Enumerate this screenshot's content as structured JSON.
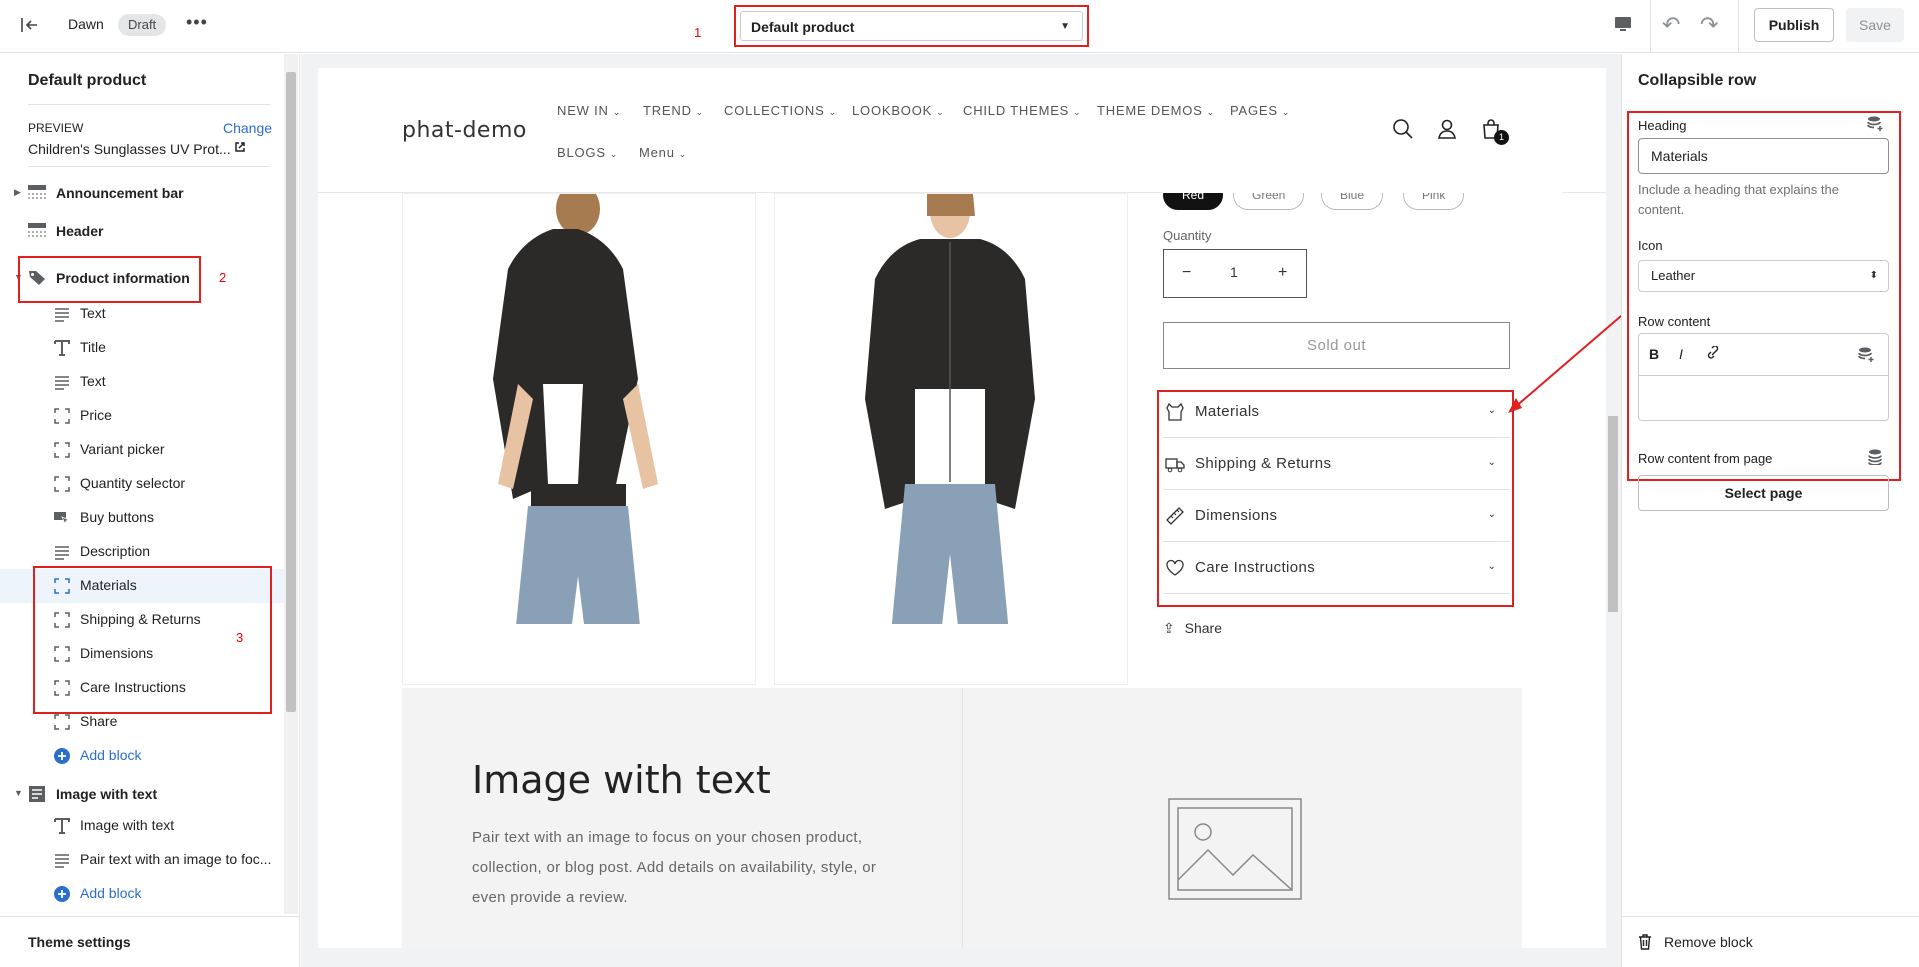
{
  "topbar": {
    "theme_name": "Dawn",
    "badge": "Draft",
    "more": "•••",
    "annotation": "1",
    "template_select": "Default product",
    "publish_label": "Publish",
    "save_label": "Save"
  },
  "left_panel": {
    "title": "Default product",
    "preview_label": "PREVIEW",
    "change_label": "Change",
    "preview_product": "Children's Sunglasses UV Prot...",
    "sections": [
      {
        "label": "Announcement bar",
        "icon": "section-icon"
      },
      {
        "label": "Header",
        "icon": "section-icon"
      },
      {
        "label": "Product information",
        "icon": "tag-icon"
      }
    ],
    "product_blocks": [
      {
        "label": "Text",
        "icon": "text-lines-icon"
      },
      {
        "label": "Title",
        "icon": "title-t-icon"
      },
      {
        "label": "Text",
        "icon": "text-lines-icon"
      },
      {
        "label": "Price",
        "icon": "dashed-square-icon"
      },
      {
        "label": "Variant picker",
        "icon": "dashed-square-icon"
      },
      {
        "label": "Quantity selector",
        "icon": "dashed-square-icon"
      },
      {
        "label": "Buy buttons",
        "icon": "cursor-button-icon"
      },
      {
        "label": "Description",
        "icon": "text-lines-icon"
      },
      {
        "label": "Materials",
        "icon": "dashed-square-icon"
      },
      {
        "label": "Shipping & Returns",
        "icon": "dashed-square-icon"
      },
      {
        "label": "Dimensions",
        "icon": "dashed-square-icon"
      },
      {
        "label": "Care Instructions",
        "icon": "dashed-square-icon"
      },
      {
        "label": "Share",
        "icon": "dashed-square-icon"
      }
    ],
    "add_block": "Add block",
    "image_with_text_section": "Image with text",
    "iwt_blocks": [
      {
        "label": "Image with text",
        "icon": "title-t-icon"
      },
      {
        "label": "Pair text with an image to foc...",
        "icon": "text-lines-icon"
      }
    ],
    "add_block_2": "Add block",
    "theme_settings": "Theme settings",
    "annotation_2": "2",
    "annotation_3": "3"
  },
  "preview": {
    "store_name": "phat-demo",
    "nav_row1": [
      "NEW IN",
      "TREND",
      "COLLECTIONS",
      "LOOKBOOK",
      "CHILD THEMES",
      "THEME DEMOS",
      "PAGES"
    ],
    "nav_row2": [
      "BLOGS",
      "Menu"
    ],
    "cart_count": "1",
    "color_pills": [
      "Red",
      "Green",
      "Blue",
      "Pink"
    ],
    "quantity_label": "Quantity",
    "quantity_value": "1",
    "minus": "−",
    "plus": "+",
    "sold_out": "Sold out",
    "accordion": [
      {
        "label": "Materials",
        "icon": "cloth-icon"
      },
      {
        "label": "Shipping & Returns",
        "icon": "truck-icon"
      },
      {
        "label": "Dimensions",
        "icon": "ruler-icon"
      },
      {
        "label": "Care Instructions",
        "icon": "heart-icon"
      }
    ],
    "share": "Share",
    "iwt_title": "Image with text",
    "iwt_text": "Pair text with an image to focus on your chosen product, collection, or blog post. Add details on availability, style, or even provide a review."
  },
  "right_panel": {
    "title": "Collapsible row",
    "heading_label": "Heading",
    "heading_value": "Materials",
    "heading_help": "Include a heading that explains the content.",
    "icon_label": "Icon",
    "icon_value": "Leather",
    "row_content_label": "Row content",
    "bold": "B",
    "italic": "I",
    "row_content_page_label": "Row content from page",
    "select_page": "Select page",
    "remove_block": "Remove block"
  },
  "colors": {
    "annotation_red": "#e02020",
    "link_blue": "#2c6ecb"
  }
}
